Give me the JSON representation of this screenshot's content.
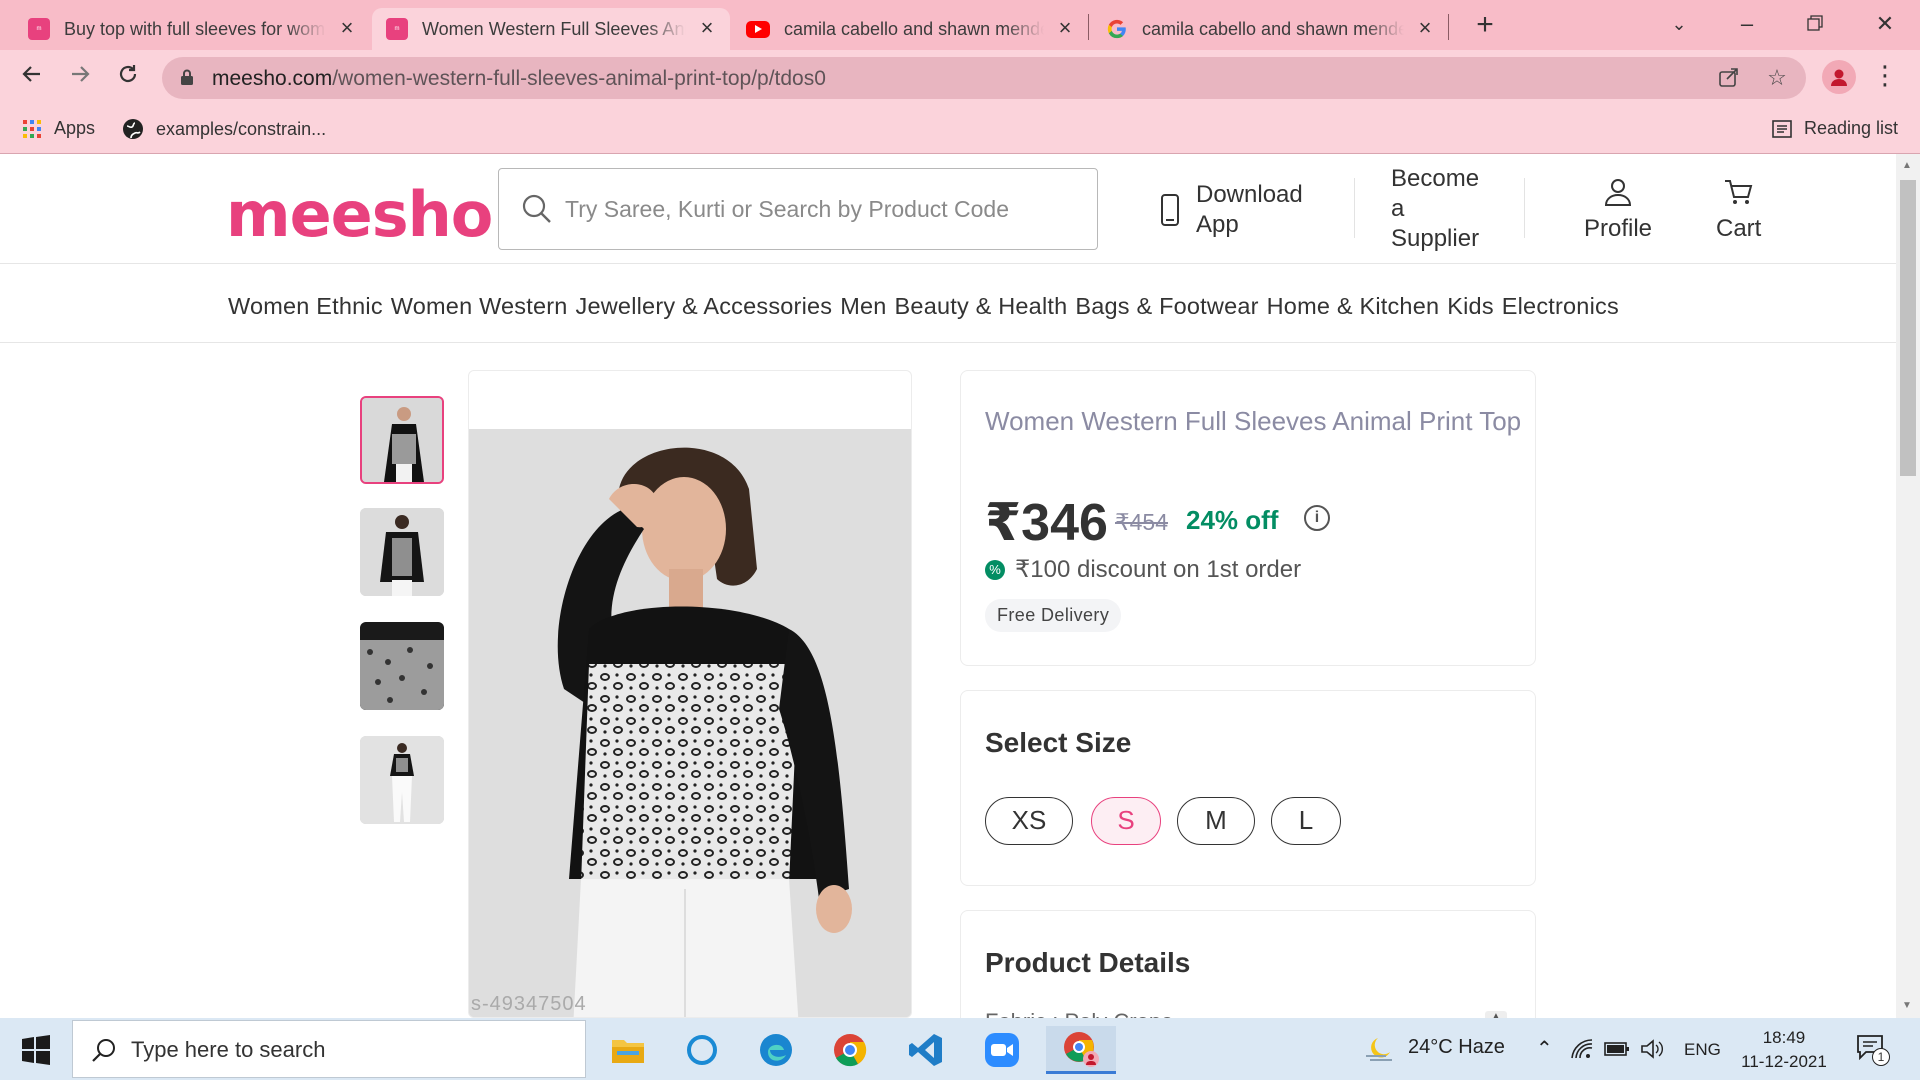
{
  "browser": {
    "tabs": [
      {
        "title": "Buy top with full sleeves for wom",
        "favicon": "meesho-favicon",
        "active": false
      },
      {
        "title": "Women Western Full Sleeves Ani",
        "favicon": "meesho-favicon",
        "active": true
      },
      {
        "title": "camila cabello and shawn mende",
        "favicon": "youtube-favicon",
        "active": false
      },
      {
        "title": "camila cabello and shawn mende",
        "favicon": "google-favicon",
        "active": false
      }
    ],
    "url_host": "meesho.com",
    "url_path": "/women-western-full-sleeves-animal-print-top/p/tdos0",
    "bookmarks": [
      {
        "label": "Apps",
        "icon": "apps-grid-icon"
      },
      {
        "label": "examples/constrain...",
        "icon": "globe-icon"
      }
    ],
    "reading_list": "Reading list",
    "colors": {
      "chrome": "#f8bcc8",
      "toolbar": "#fbd3db"
    }
  },
  "site": {
    "logo": "meesho",
    "search_placeholder": "Try Saree, Kurti or Search by Product Code",
    "header": {
      "download_line1": "Download",
      "download_line2": "App",
      "supplier_line1": "Become",
      "supplier_line2": "a",
      "supplier_line3": "Supplier",
      "profile": "Profile",
      "cart": "Cart"
    },
    "categories": [
      "Women Ethnic",
      "Women Western",
      "Jewellery & Accessories",
      "Men",
      "Beauty & Health",
      "Bags & Footwear",
      "Home & Kitchen",
      "Kids",
      "Electronics"
    ],
    "brand_color": "#e8417e"
  },
  "product": {
    "title": "Women Western Full Sleeves Animal Print Top",
    "price": "₹346",
    "mrp": "₹454",
    "discount": "24% off",
    "first_order_offer": "₹100 discount on 1st order",
    "delivery": "Free Delivery",
    "image_watermark": "s-49347504",
    "select_size_heading": "Select Size",
    "sizes": [
      "XS",
      "S",
      "M",
      "L"
    ],
    "selected_size": "S",
    "details_heading": "Product Details",
    "details_first_line": "Fabric : Poly Crepe"
  },
  "taskbar": {
    "search_placeholder": "Type here to search",
    "weather": "24°C  Haze",
    "language": "ENG",
    "time": "18:49",
    "date": "11-12-2021",
    "notification_count": "1",
    "apps": [
      "file-explorer-icon",
      "cortana-icon",
      "edge-icon",
      "chrome-icon",
      "vscode-icon",
      "zoom-icon",
      "chrome-profile-icon"
    ]
  }
}
